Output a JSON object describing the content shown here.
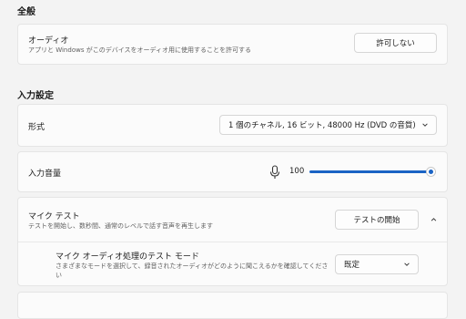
{
  "general": {
    "section_title": "全般",
    "audio": {
      "title": "オーディオ",
      "description": "アプリと Windows がこのデバイスをオーディオ用に使用することを許可する",
      "button": "許可しない"
    }
  },
  "input_settings": {
    "section_title": "入力設定",
    "format": {
      "label": "形式",
      "selected_value": "1 個のチャネル, 16 ビット, 48000 Hz (DVD の音質)"
    },
    "volume": {
      "label": "入力音量",
      "value": "100",
      "level": 1.0
    },
    "mic_test": {
      "title": "マイク テスト",
      "description": "テストを開始し、数秒間、通常のレベルで話す音声を再生します",
      "button": "テストの開始",
      "mode": {
        "title": "マイク オーディオ処理のテスト モード",
        "description_line1": "さまざまなモードを選択して、録音されたオーディオがどのように聞こえるかを確認してくださ",
        "description_line2": "い",
        "selected_value": "既定"
      }
    }
  },
  "icons": {
    "microphone": "microphone-icon",
    "chevron_down": "chevron-down-icon",
    "chevron_up": "chevron-up-icon"
  },
  "colors": {
    "accent": "#1a63c4",
    "background": "#f3f3f3",
    "card": "#fbfbfb"
  }
}
